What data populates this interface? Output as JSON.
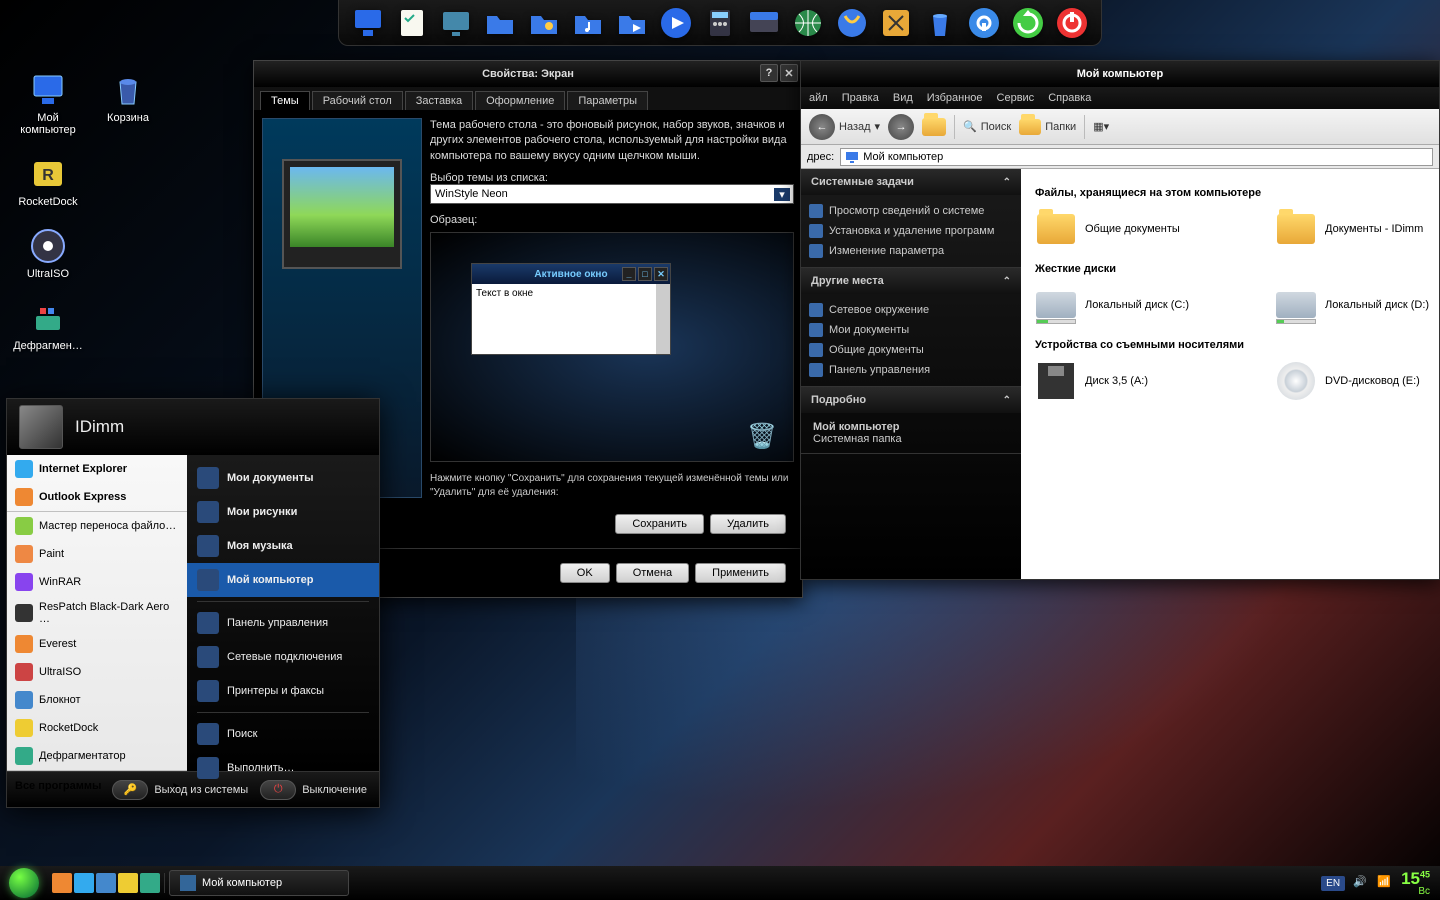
{
  "desktop": {
    "icons": [
      {
        "label": "Мой\nкомпьютер"
      },
      {
        "label": "Корзина"
      },
      {
        "label": "RocketDock"
      },
      {
        "label": "UltraISO"
      },
      {
        "label": "Дефрагмен…"
      }
    ]
  },
  "display_dialog": {
    "title": "Свойства: Экран",
    "tabs": [
      "Темы",
      "Рабочий стол",
      "Заставка",
      "Оформление",
      "Параметры"
    ],
    "desc": "Тема рабочего стола - это фоновый рисунок, набор звуков, значков и других элементов рабочего стола, используемый для настройки вида компьютера по вашему вкусу одним щелчком мыши.",
    "theme_label": "Выбор темы из списка:",
    "theme_value": "WinStyle Neon",
    "sample_label": "Образец:",
    "active_window_title": "Активное окно",
    "window_text": "Текст в окне",
    "hint": "Нажмите кнопку \"Сохранить\" для сохранения текущей изменённой темы или \"Удалить\" для её удаления:",
    "btn_save": "Сохранить",
    "btn_delete": "Удалить",
    "btn_ok": "OK",
    "btn_cancel": "Отмена",
    "btn_apply": "Применить"
  },
  "explorer": {
    "title": "Мой компьютер",
    "menu": [
      "айл",
      "Правка",
      "Вид",
      "Избранное",
      "Сервис",
      "Справка"
    ],
    "toolbar": {
      "back": "Назад",
      "search": "Поиск",
      "folders": "Папки"
    },
    "address_label": "дрес:",
    "address_value": "Мой компьютер",
    "side_groups": [
      {
        "title": "Системные задачи",
        "items": [
          "Просмотр сведений о системе",
          "Установка и удаление программ",
          "Изменение параметра"
        ]
      },
      {
        "title": "Другие места",
        "items": [
          "Сетевое окружение",
          "Мои документы",
          "Общие документы",
          "Панель управления"
        ]
      },
      {
        "title": "Подробно",
        "items": []
      }
    ],
    "details": {
      "name": "Мой компьютер",
      "type": "Системная папка"
    },
    "sections": [
      {
        "heading": "Файлы, хранящиеся на этом компьютере",
        "items": [
          {
            "label": "Общие документы",
            "type": "folder"
          },
          {
            "label": "Документы - IDimm",
            "type": "folder"
          }
        ]
      },
      {
        "heading": "Жесткие диски",
        "items": [
          {
            "label": "Локальный диск (C:)",
            "type": "drive",
            "fill": 30
          },
          {
            "label": "Локальный диск (D:)",
            "type": "drive",
            "fill": 18
          }
        ]
      },
      {
        "heading": "Устройства со съемными носителями",
        "items": [
          {
            "label": "Диск 3,5 (A:)",
            "type": "floppy"
          },
          {
            "label": "DVD-дисковод (E:)",
            "type": "dvd"
          }
        ]
      }
    ]
  },
  "start_menu": {
    "user": "IDimm",
    "pinned": [
      {
        "label": "Internet Explorer"
      },
      {
        "label": "Outlook Express"
      }
    ],
    "recent": [
      {
        "label": "Мастер переноса файло…"
      },
      {
        "label": "Paint"
      },
      {
        "label": "WinRAR"
      },
      {
        "label": "ResPatch Black-Dark Aero …"
      },
      {
        "label": "Everest"
      },
      {
        "label": "UltraISO"
      },
      {
        "label": "Блокнот"
      },
      {
        "label": "RocketDock"
      },
      {
        "label": "Дефрагментатор"
      }
    ],
    "all_programs": "Все программы",
    "right": [
      {
        "label": "Мои документы",
        "bold": true
      },
      {
        "label": "Мои рисунки",
        "bold": true
      },
      {
        "label": "Моя музыка",
        "bold": true
      },
      {
        "label": "Мой компьютер",
        "bold": true,
        "hl": true
      },
      {
        "label": "Панель управления"
      },
      {
        "label": "Сетевые подключения"
      },
      {
        "label": "Принтеры и факсы"
      },
      {
        "label": "Поиск"
      },
      {
        "label": "Выполнить…"
      }
    ],
    "logoff": "Выход из системы",
    "shutdown": "Выключение"
  },
  "taskbar": {
    "task": "Мой компьютер",
    "lang": "EN",
    "time": "15",
    "time_min": "45",
    "day": "Вс"
  }
}
